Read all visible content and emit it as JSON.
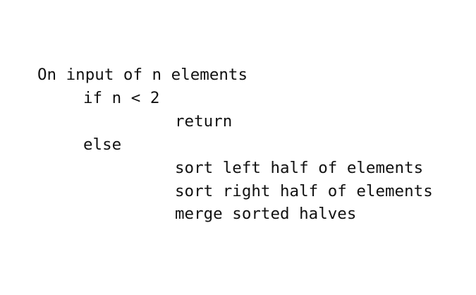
{
  "pseudocode": {
    "lines": [
      "On input of n elements",
      "if n < 2",
      "return",
      "else",
      "sort left half of elements",
      "sort right half of elements",
      "merge sorted halves"
    ]
  }
}
